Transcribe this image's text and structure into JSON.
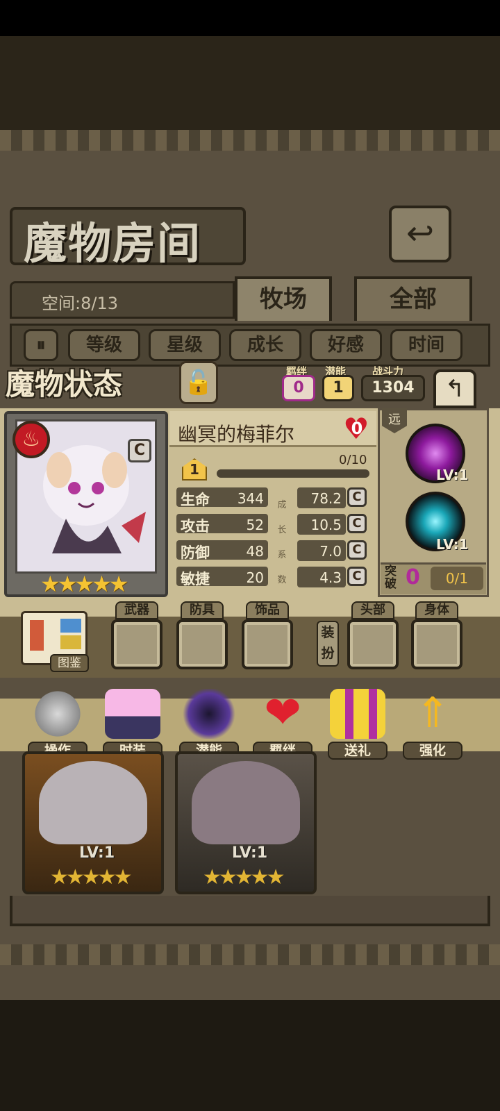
{
  "room": {
    "title": "魔物房间",
    "space_label": "空间:8/13",
    "tabs": [
      {
        "label": "牧场"
      },
      {
        "label": "全部"
      }
    ],
    "sort_buttons": [
      {
        "label": "等级"
      },
      {
        "label": "星级"
      },
      {
        "label": "成长"
      },
      {
        "label": "好感"
      },
      {
        "label": "时间"
      }
    ],
    "sort_toggle_label": "⏸"
  },
  "status": {
    "header": "魔物状态",
    "bond_label": "羁绊",
    "bond_value": "0",
    "potential_label": "潜能",
    "potential_value": "1",
    "power_label": "战斗力",
    "power_value": "1304",
    "monster_name": "幽冥的梅菲尔",
    "favor_value": "0",
    "rank": "C",
    "level_badge": "1",
    "xp_text": "0/10",
    "xp_fraction": 0.0,
    "stars": "★★★★★",
    "stats": [
      {
        "label": "生命",
        "value": "344",
        "growth": "78.2",
        "grade": "C"
      },
      {
        "label": "攻击",
        "value": "52",
        "growth": "10.5",
        "grade": "C"
      },
      {
        "label": "防御",
        "value": "48",
        "growth": "7.0",
        "grade": "C"
      },
      {
        "label": "敏捷",
        "value": "20",
        "growth": "4.3",
        "grade": "C"
      }
    ],
    "growth_vertical": [
      "成",
      "长",
      "系",
      "数"
    ],
    "range_label": "远",
    "skills": [
      {
        "lv": "LV:1"
      },
      {
        "lv": "LV:1"
      }
    ],
    "break_label": "突破",
    "break_value": "0",
    "break_progress": "0/1"
  },
  "equipment": {
    "book_label": "图鉴",
    "slots_left": [
      {
        "label": "武器"
      },
      {
        "label": "防具"
      },
      {
        "label": "饰品"
      }
    ],
    "equip_vertical": "装扮",
    "slots_right": [
      {
        "label": "头部"
      },
      {
        "label": "身体"
      }
    ]
  },
  "actions": [
    {
      "label": "操作",
      "icon": "gear-icon"
    },
    {
      "label": "时装",
      "icon": "costume-icon"
    },
    {
      "label": "潜能",
      "icon": "potential-icon"
    },
    {
      "label": "羁绊",
      "icon": "hearts-icon"
    },
    {
      "label": "送礼",
      "icon": "gift-icon"
    },
    {
      "label": "强化",
      "icon": "upgrade-arrows-icon"
    }
  ],
  "cards": [
    {
      "lv": "LV:1",
      "stars": "★★★★★"
    },
    {
      "lv": "LV:1",
      "stars": "★★★★★"
    }
  ],
  "colors": {
    "accent_gold": "#f5c332",
    "favor_red": "#d21b2a",
    "fire_red": "#c21a24",
    "skill1": "#8e1a9e",
    "skill2": "#1aa7b8"
  }
}
